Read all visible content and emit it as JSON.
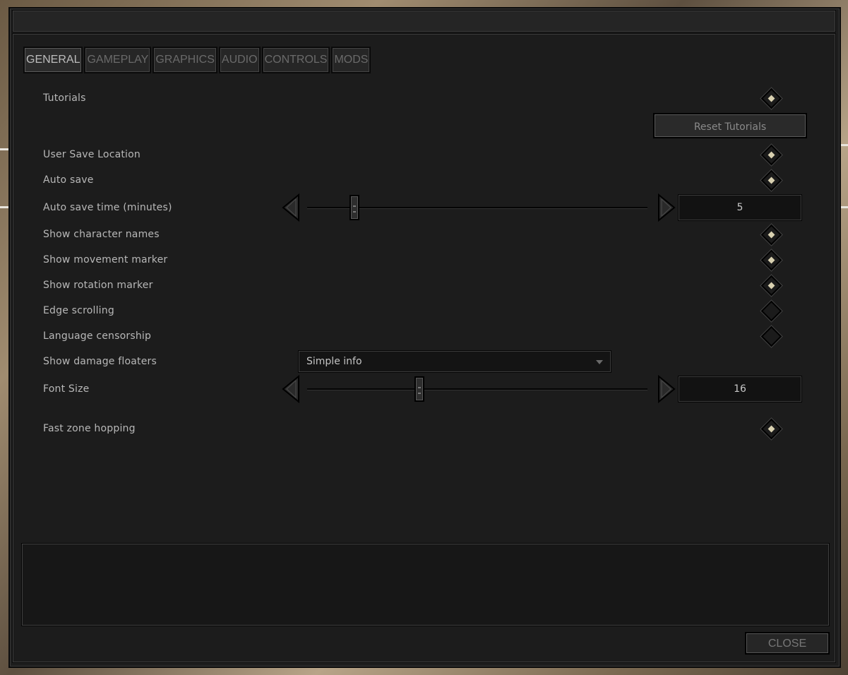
{
  "tabs": [
    {
      "label": "GENERAL",
      "active": true
    },
    {
      "label": "GAMEPLAY",
      "active": false
    },
    {
      "label": "GRAPHICS",
      "active": false
    },
    {
      "label": "AUDIO",
      "active": false
    },
    {
      "label": "CONTROLS",
      "active": false
    },
    {
      "label": "MODS",
      "active": false
    }
  ],
  "settings": {
    "tutorials": {
      "label": "Tutorials",
      "checked": true
    },
    "reset_tutorials": {
      "label": "Reset Tutorials"
    },
    "user_save_location": {
      "label": "User Save Location",
      "checked": true
    },
    "auto_save": {
      "label": "Auto save",
      "checked": true
    },
    "auto_save_time": {
      "label": "Auto save time (minutes)",
      "value": "5",
      "fraction": 0.14
    },
    "show_character_names": {
      "label": "Show character names",
      "checked": true
    },
    "show_movement_marker": {
      "label": "Show movement marker",
      "checked": true
    },
    "show_rotation_marker": {
      "label": "Show rotation marker",
      "checked": true
    },
    "edge_scrolling": {
      "label": "Edge scrolling",
      "checked": false
    },
    "language_censorship": {
      "label": "Language censorship",
      "checked": false
    },
    "show_damage_floaters": {
      "label": "Show damage floaters",
      "selected": "Simple info"
    },
    "font_size": {
      "label": "Font Size",
      "value": "16",
      "fraction": 0.33
    },
    "fast_zone_hopping": {
      "label": "Fast zone hopping",
      "checked": true
    }
  },
  "close_label": "CLOSE",
  "colors": {
    "panel": "#1c1c1c",
    "text": "#b8b8b8",
    "check_dot": "#d8d0b0"
  }
}
